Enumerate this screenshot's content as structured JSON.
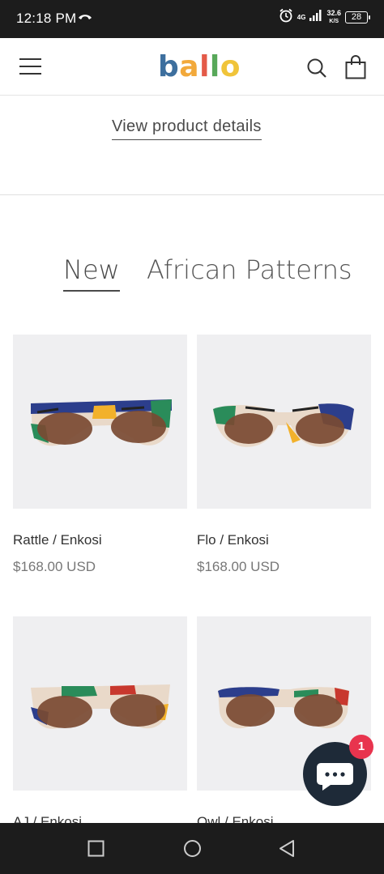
{
  "status_bar": {
    "time": "12:18 PM",
    "network": "4G",
    "speed_value": "32.6",
    "speed_unit": "K/S",
    "battery": "28"
  },
  "header": {
    "logo": "ballo",
    "logo_colors": [
      "#3d6f9e",
      "#f2a93b",
      "#e45a48",
      "#58a85a",
      "#f0c43a"
    ]
  },
  "product_link": "View product details",
  "tabs": [
    {
      "label": "New",
      "active": true
    },
    {
      "label": "African Patterns",
      "active": false
    }
  ],
  "products": [
    {
      "name": "Rattle / Enkosi",
      "price": "$168.00 USD"
    },
    {
      "name": "Flo / Enkosi",
      "price": "$168.00 USD"
    },
    {
      "name": "AJ / Enkosi",
      "price": ""
    },
    {
      "name": "Owl / Enkosi",
      "price": ""
    }
  ],
  "chat": {
    "badge_count": "1"
  },
  "icons": {
    "menu": "hamburger-menu-icon",
    "search": "search-icon",
    "bag": "shopping-bag-icon",
    "chat": "chat-bubble-icon",
    "nav_recents": "square-recents-icon",
    "nav_home": "circle-home-icon",
    "nav_back": "triangle-back-icon"
  }
}
